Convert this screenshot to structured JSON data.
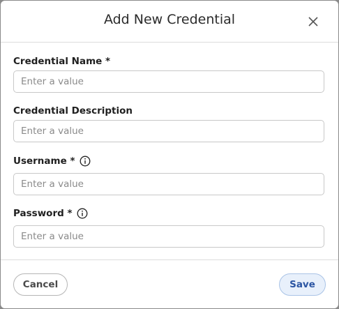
{
  "dialog": {
    "title": "Add New Credential",
    "close_icon": "close-icon"
  },
  "fields": [
    {
      "label": "Credential Name *",
      "placeholder": "Enter a value",
      "value": ""
    },
    {
      "label": "Credential Description",
      "placeholder": "Enter a value",
      "value": ""
    },
    {
      "label": "Username *",
      "placeholder": "Enter a value",
      "value": "",
      "icon": "info-icon"
    },
    {
      "label": "Password *",
      "placeholder": "Enter a value",
      "value": "",
      "icon": "info-icon"
    }
  ],
  "footer": {
    "cancel_label": "Cancel",
    "save_label": "Save"
  },
  "colors": {
    "save_text": "#2b55a3",
    "save_bg": "#e8f0fb",
    "backdrop": "#8a8a8a"
  }
}
